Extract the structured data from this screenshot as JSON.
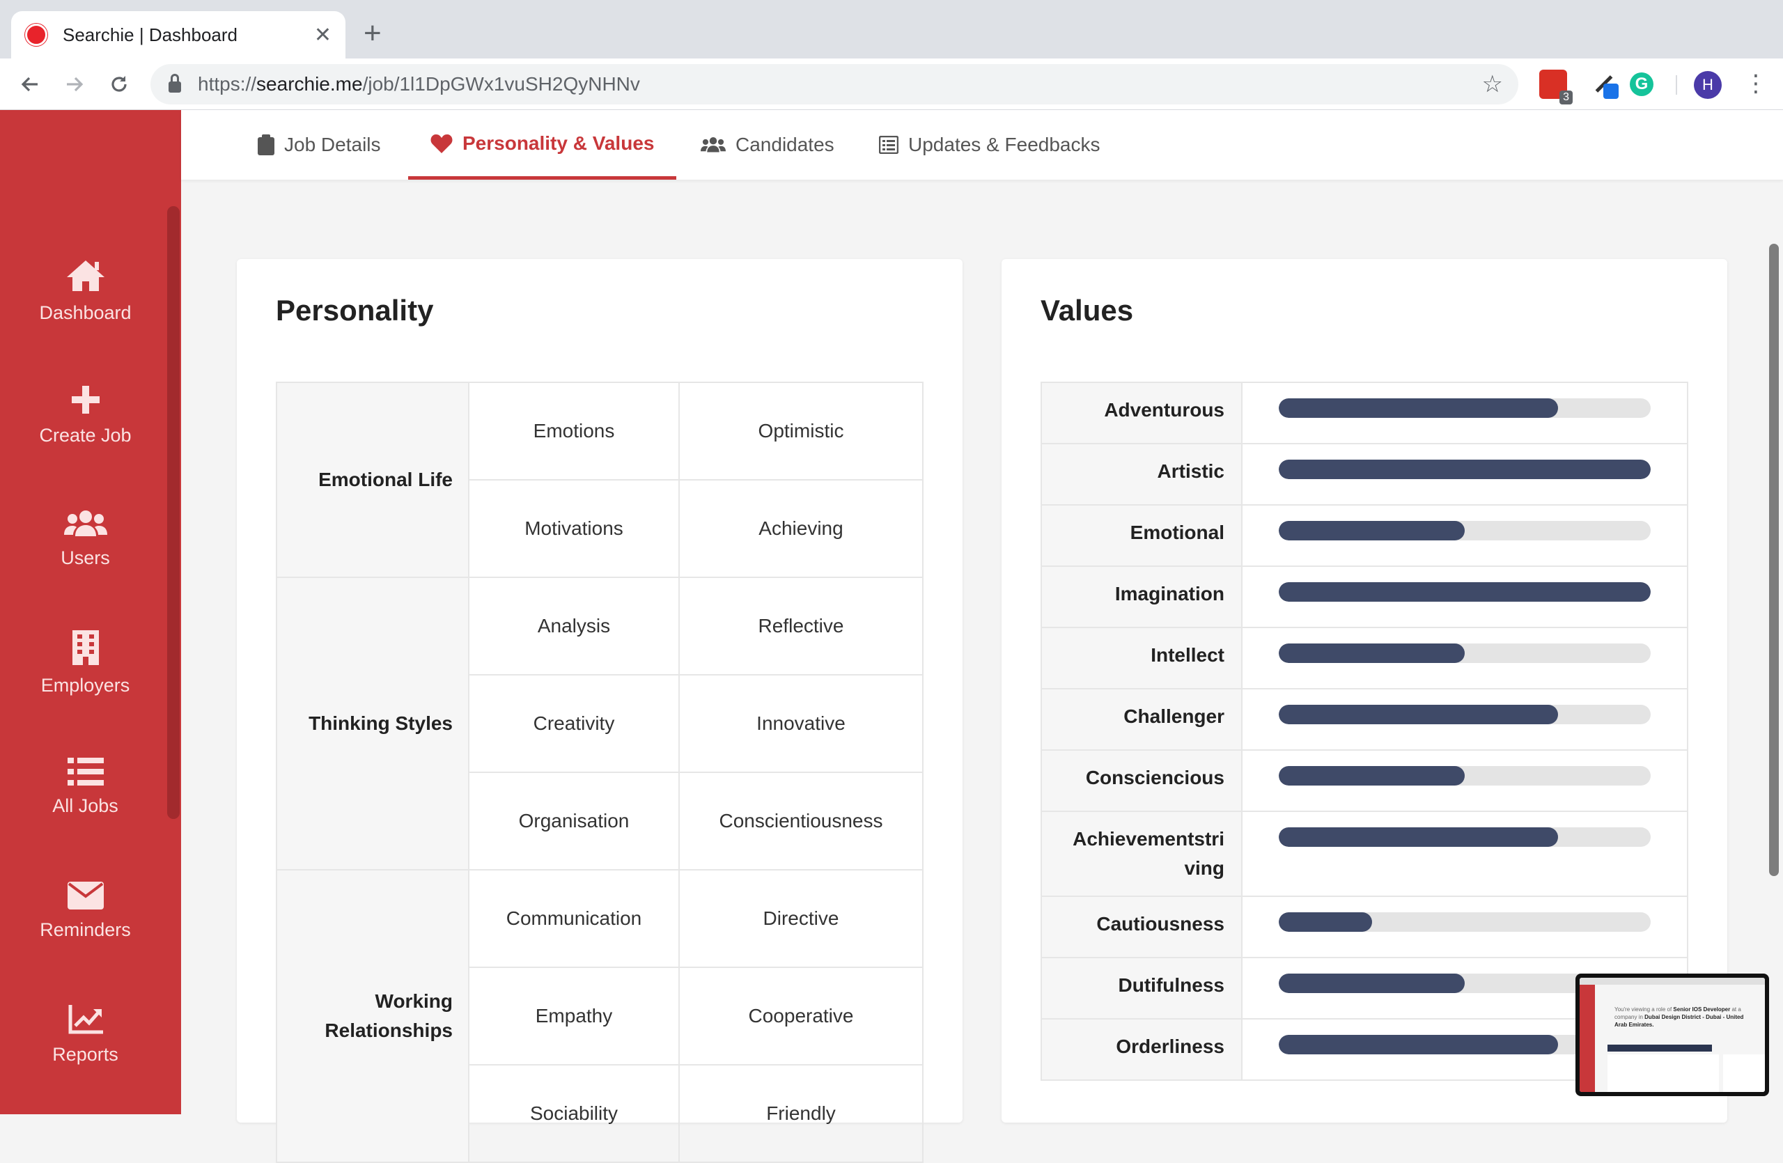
{
  "browser": {
    "tab_title": "Searchie | Dashboard",
    "url_scheme": "https://",
    "url_host": "searchie.me",
    "url_path": "/job/1l1DpGWx1vuSH2QyNHNv",
    "extension_badge": "3",
    "avatar_letter": "H"
  },
  "sidebar": {
    "items": [
      {
        "label": "Dashboard",
        "icon": "home-icon"
      },
      {
        "label": "Create Job",
        "icon": "plus-icon"
      },
      {
        "label": "Users",
        "icon": "users-icon"
      },
      {
        "label": "Employers",
        "icon": "building-icon"
      },
      {
        "label": "All Jobs",
        "icon": "list-icon"
      },
      {
        "label": "Reminders",
        "icon": "envelope-icon"
      },
      {
        "label": "Reports",
        "icon": "chart-icon"
      }
    ]
  },
  "tabs": [
    {
      "label": "Job Details",
      "icon": "clipboard-icon"
    },
    {
      "label": "Personality & Values",
      "icon": "heart-icon",
      "active": true
    },
    {
      "label": "Candidates",
      "icon": "users-icon"
    },
    {
      "label": "Updates & Feedbacks",
      "icon": "list-alt-icon"
    }
  ],
  "personality": {
    "title": "Personality",
    "groups": [
      {
        "name": "Emotional Life",
        "rows": [
          {
            "trait": "Emotions",
            "value": "Optimistic"
          },
          {
            "trait": "Motivations",
            "value": "Achieving"
          }
        ]
      },
      {
        "name": "Thinking Styles",
        "rows": [
          {
            "trait": "Analysis",
            "value": "Reflective"
          },
          {
            "trait": "Creativity",
            "value": "Innovative"
          },
          {
            "trait": "Organisation",
            "value": "Conscientiousness"
          }
        ]
      },
      {
        "name": "Working Relationships",
        "rows": [
          {
            "trait": "Communication",
            "value": "Directive"
          },
          {
            "trait": "Empathy",
            "value": "Cooperative"
          },
          {
            "trait": "Sociability",
            "value": "Friendly"
          }
        ]
      }
    ]
  },
  "values": {
    "title": "Values",
    "items": [
      {
        "name": "Adventurous",
        "level": 0.75
      },
      {
        "name": "Artistic",
        "level": 1.0
      },
      {
        "name": "Emotional",
        "level": 0.5
      },
      {
        "name": "Imagination",
        "level": 1.0
      },
      {
        "name": "Intellect",
        "level": 0.5
      },
      {
        "name": "Challenger",
        "level": 0.75
      },
      {
        "name": "Consciencious",
        "level": 0.5
      },
      {
        "name": "Achievementstriving",
        "level": 0.75
      },
      {
        "name": "Cautiousness",
        "level": 0.25
      },
      {
        "name": "Dutifulness",
        "level": 0.5
      },
      {
        "name": "Orderliness",
        "level": 0.75
      }
    ]
  },
  "thumbnail": {
    "line1": "You're viewing a role of",
    "role": "Senior IOS Developer",
    "line2": "at a company in",
    "location": "Dubai Design District - Dubai - United Arab Emirates."
  },
  "colors": {
    "brand": "#c8373a",
    "bar_fill": "#3f4a68",
    "bar_track": "#e4e4e4"
  }
}
